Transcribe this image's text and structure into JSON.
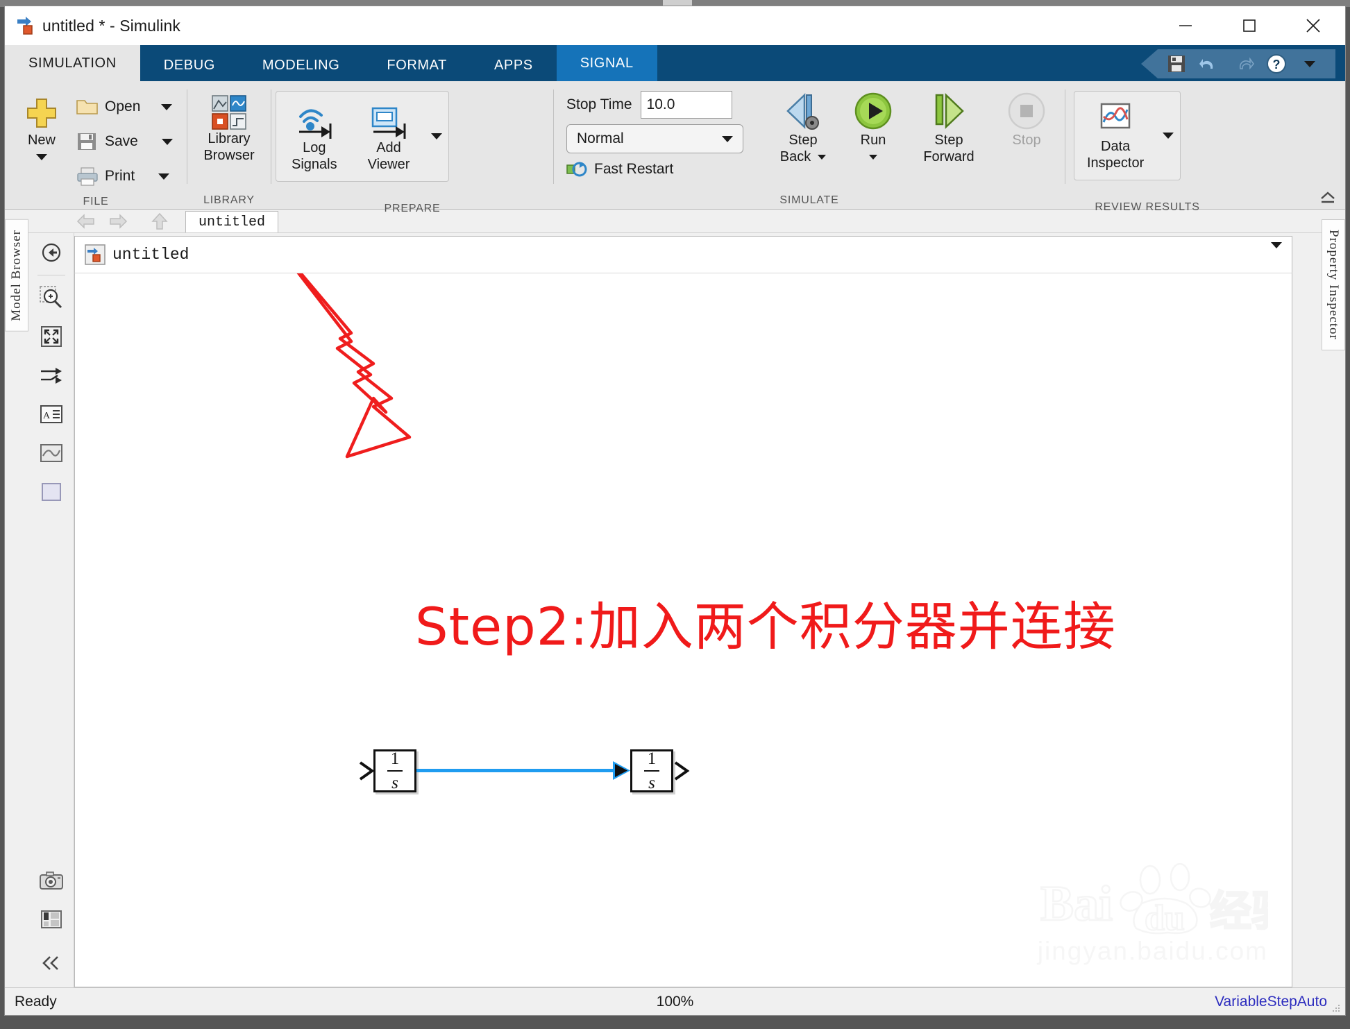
{
  "window": {
    "title": "untitled * - Simulink",
    "minimize_label": "Minimize",
    "maximize_label": "Maximize",
    "close_label": "Close"
  },
  "ribbon_tabs": [
    {
      "label": "SIMULATION",
      "state": "active"
    },
    {
      "label": "DEBUG",
      "state": "normal"
    },
    {
      "label": "MODELING",
      "state": "normal"
    },
    {
      "label": "FORMAT",
      "state": "normal"
    },
    {
      "label": "APPS",
      "state": "normal"
    },
    {
      "label": "SIGNAL",
      "state": "contextual"
    }
  ],
  "quick_access": [
    {
      "name": "save-icon",
      "label": "Save"
    },
    {
      "name": "undo-icon",
      "label": "Undo"
    },
    {
      "name": "redo-icon",
      "label": "Redo"
    },
    {
      "name": "help-icon",
      "label": "Help"
    },
    {
      "name": "chevron-down-icon",
      "label": "More"
    }
  ],
  "ribbon": {
    "file": {
      "title": "FILE",
      "new_label": "New",
      "open_label": "Open",
      "save_label": "Save",
      "print_label": "Print"
    },
    "library": {
      "title": "LIBRARY",
      "browser_label_line1": "Library",
      "browser_label_line2": "Browser"
    },
    "prepare": {
      "title": "PREPARE",
      "log_signals_line1": "Log",
      "log_signals_line2": "Signals",
      "add_viewer_line1": "Add",
      "add_viewer_line2": "Viewer"
    },
    "simulate": {
      "title": "SIMULATE",
      "stop_time_label": "Stop Time",
      "stop_time_value": "10.0",
      "mode_value": "Normal",
      "fast_restart_label": "Fast Restart",
      "step_back_line1": "Step",
      "step_back_line2": "Back",
      "run_label": "Run",
      "step_forward_line1": "Step",
      "step_forward_line2": "Forward",
      "stop_label": "Stop"
    },
    "review": {
      "title": "REVIEW RESULTS",
      "data_inspector_line1": "Data",
      "data_inspector_line2": "Inspector"
    }
  },
  "panels": {
    "left_tab": "Model Browser",
    "right_tab": "Property Inspector"
  },
  "navigation": {
    "back_label": "Back",
    "forward_label": "Forward",
    "up_label": "Up to Parent",
    "model_tab": "untitled"
  },
  "breadcrumb": {
    "model_name": "untitled"
  },
  "canvas_tools": [
    {
      "name": "navigate-back-icon",
      "label": "Back"
    },
    {
      "name": "zoom-in-icon",
      "label": "Zoom In"
    },
    {
      "name": "fit-to-view-icon",
      "label": "Fit to View"
    },
    {
      "name": "signal-routing-icon",
      "label": "Signal Routing"
    },
    {
      "name": "annotation-icon",
      "label": "Add Annotation"
    },
    {
      "name": "scope-icon",
      "label": "Scope"
    },
    {
      "name": "area-icon",
      "label": "Area"
    },
    {
      "name": "snapshot-icon",
      "label": "Snapshot"
    },
    {
      "name": "legend-icon",
      "label": "Legend"
    },
    {
      "name": "collapse-icon",
      "label": "Collapse"
    }
  ],
  "diagram": {
    "annotation_text": "Step2:加入两个积分器并连接",
    "annotation_color": "#f01a1a",
    "blocks": [
      {
        "name": "integrator-1",
        "numerator": "1",
        "denominator": "s"
      },
      {
        "name": "integrator-2",
        "numerator": "1",
        "denominator": "s"
      }
    ],
    "signal_color": "#1f9cf0"
  },
  "watermark": {
    "line1": "Baidu",
    "line2": "jingyan.baidu.com"
  },
  "statusbar": {
    "status": "Ready",
    "zoom": "100%",
    "solver": "VariableStepAuto"
  }
}
